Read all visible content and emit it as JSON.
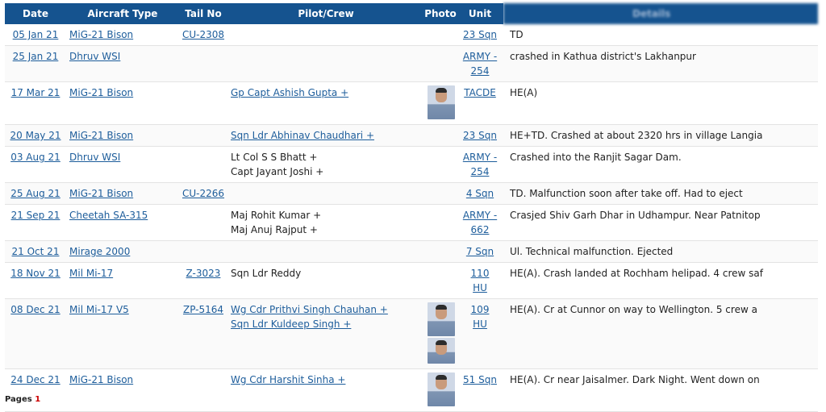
{
  "columns": [
    "Date",
    "Aircraft Type",
    "Tail No",
    "Pilot/Crew",
    "Photo",
    "Unit",
    "Details"
  ],
  "rows": [
    {
      "date": "05 Jan 21",
      "aircraft": "MiG-21 Bison",
      "tail": "CU-2308",
      "crew": [],
      "photos": 0,
      "unit": "23 Sqn",
      "desc": "TD"
    },
    {
      "date": "25 Jan 21",
      "aircraft": "Dhruv WSI",
      "tail": "",
      "crew": [],
      "photos": 0,
      "unit": "ARMY - 254",
      "desc": "crashed in Kathua district's Lakhanpur"
    },
    {
      "date": "17 Mar 21",
      "aircraft": "MiG-21 Bison",
      "tail": "",
      "crew": [
        {
          "name": "Gp Capt Ashish Gupta +",
          "link": true
        }
      ],
      "photos": 1,
      "unit": "TACDE",
      "desc": "HE(A)"
    },
    {
      "date": "20 May 21",
      "aircraft": "MiG-21 Bison",
      "tail": "",
      "crew": [
        {
          "name": "Sqn Ldr Abhinav Chaudhari +",
          "link": true
        }
      ],
      "photos": 0,
      "unit": "23 Sqn",
      "desc": "HE+TD. Crashed at about 2320 hrs in village Langia"
    },
    {
      "date": "03 Aug 21",
      "aircraft": "Dhruv WSI",
      "tail": "",
      "crew": [
        {
          "name": "Lt Col S S Bhatt +",
          "link": false
        },
        {
          "name": "Capt Jayant Joshi +",
          "link": false
        }
      ],
      "photos": 0,
      "unit": "ARMY - 254",
      "desc": "Crashed into the Ranjit Sagar Dam."
    },
    {
      "date": "25 Aug 21",
      "aircraft": "MiG-21 Bison",
      "tail": "CU-2266",
      "crew": [],
      "photos": 0,
      "unit": "4 Sqn",
      "desc": "TD. Malfunction soon after take off. Had to eject"
    },
    {
      "date": "21 Sep 21",
      "aircraft": "Cheetah SA-315",
      "tail": "",
      "crew": [
        {
          "name": "Maj Rohit Kumar +",
          "link": false
        },
        {
          "name": "Maj Anuj Rajput +",
          "link": false
        }
      ],
      "photos": 0,
      "unit": "ARMY - 662",
      "desc": "Crasjed Shiv Garh Dhar in Udhampur. Near Patnitop"
    },
    {
      "date": "21 Oct 21",
      "aircraft": "Mirage 2000",
      "tail": "",
      "crew": [],
      "photos": 0,
      "unit": "7 Sqn",
      "desc": "Ul. Technical malfunction. Ejected"
    },
    {
      "date": "18 Nov 21",
      "aircraft": "Mil Mi-17",
      "tail": "Z-3023",
      "crew": [
        {
          "name": "Sqn Ldr Reddy",
          "link": false
        }
      ],
      "photos": 0,
      "unit": "110 HU",
      "desc": "HE(A). Crash landed at Rochham helipad. 4 crew saf"
    },
    {
      "date": "08 Dec 21",
      "aircraft": "Mil Mi-17 V5",
      "tail": "ZP-5164",
      "crew": [
        {
          "name": "Wg Cdr Prithvi Singh Chauhan +",
          "link": true
        },
        {
          "name": "Sqn Ldr Kuldeep Singh +",
          "link": true
        }
      ],
      "photos": 2,
      "unit": "109 HU",
      "desc": "HE(A). Cr at Cunnor on way to Wellington. 5 crew a"
    },
    {
      "date": "24 Dec 21",
      "aircraft": "MiG-21 Bison",
      "tail": "",
      "crew": [
        {
          "name": "Wg Cdr Harshit Sinha +",
          "link": true
        }
      ],
      "photos": 1,
      "unit": "51 Sqn",
      "desc": "HE(A). Cr near Jaisalmer. Dark Night. Went down on"
    }
  ],
  "pager": {
    "label": "Pages",
    "current": "1"
  }
}
